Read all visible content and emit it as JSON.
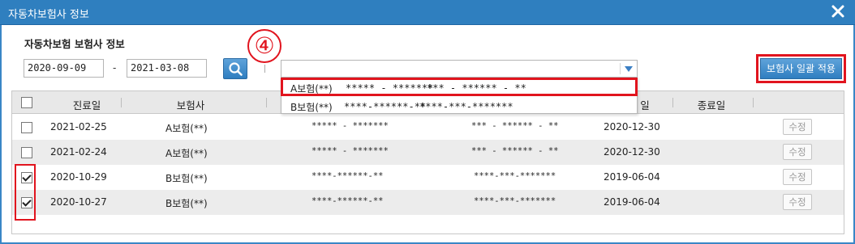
{
  "window": {
    "title": "자동차보험사 정보"
  },
  "section": {
    "title": "자동차보험 보험사 정보"
  },
  "filters": {
    "start_date": "2020-09-09",
    "dash": "-",
    "end_date": "2021-03-08",
    "insurer_select_value": ""
  },
  "annotation": {
    "step": "④"
  },
  "dropdown": {
    "options": [
      {
        "name": "A보험(**)",
        "code1": "***** - *******",
        "code2": "*** - ****** - **"
      },
      {
        "name": "B보험(**)",
        "code1": "****-******-**",
        "code2": "****-***-*******"
      }
    ]
  },
  "buttons": {
    "bulk_apply": "보험사 일괄 적용"
  },
  "table": {
    "headers": [
      "진료일",
      "보험사",
      "",
      "",
      "일",
      "종료일"
    ],
    "edit_label": "수정",
    "rows": [
      {
        "checked": false,
        "date": "2021-02-25",
        "insurer": "A보험(**)",
        "code1": "***** - *******",
        "code2": "*** - ****** - **",
        "start": "2020-12-30"
      },
      {
        "checked": false,
        "date": "2021-02-24",
        "insurer": "A보험(**)",
        "code1": "***** - *******",
        "code2": "*** - ****** - **",
        "start": "2020-12-30"
      },
      {
        "checked": true,
        "date": "2020-10-29",
        "insurer": "B보험(**)",
        "code1": "****-******-**",
        "code2": "****-***-*******",
        "start": "2019-06-04"
      },
      {
        "checked": true,
        "date": "2020-10-27",
        "insurer": "B보험(**)",
        "code1": "****-******-**",
        "code2": "****-***-*******",
        "start": "2019-06-04"
      }
    ]
  },
  "colors": {
    "accent": "#2f7fbf",
    "highlight": "#e1141e"
  }
}
